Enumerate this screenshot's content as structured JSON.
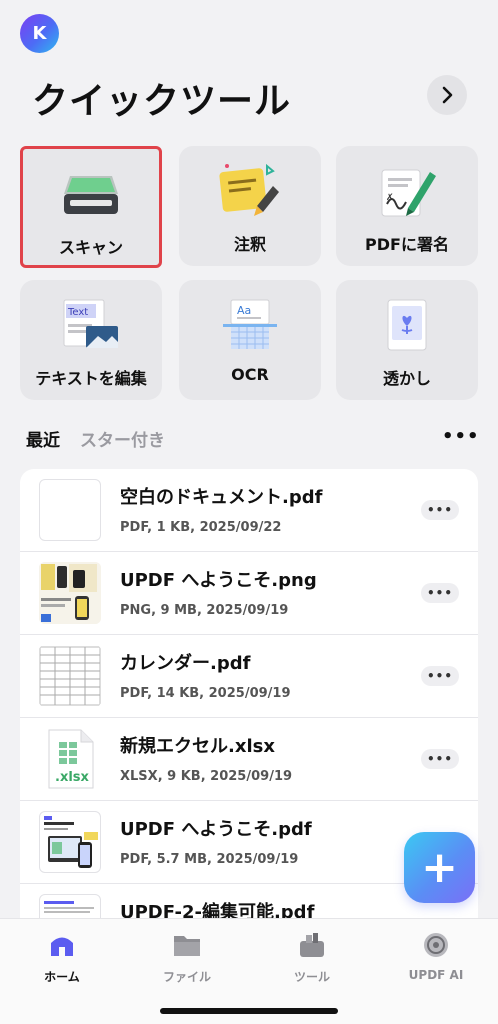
{
  "header": {
    "avatar_letter": "K",
    "title": "クイックツール"
  },
  "tools": [
    {
      "label": "スキャン",
      "icon": "scanner-icon"
    },
    {
      "label": "注釈",
      "icon": "notes-icon"
    },
    {
      "label": "PDFに署名",
      "icon": "signature-icon"
    },
    {
      "label": "テキストを編集",
      "icon": "edit-text-icon"
    },
    {
      "label": "OCR",
      "icon": "ocr-icon"
    },
    {
      "label": "透かし",
      "icon": "watermark-icon"
    }
  ],
  "tabs": {
    "recent": "最近",
    "starred": "スター付き",
    "more": "•••"
  },
  "files": [
    {
      "name": "空白のドキュメント.pdf",
      "meta": "PDF, 1 KB, 2025/09/22"
    },
    {
      "name": "UPDF へようこそ.png",
      "meta": "PNG, 9 MB, 2025/09/19"
    },
    {
      "name": "カレンダー.pdf",
      "meta": "PDF, 14 KB, 2025/09/19"
    },
    {
      "name": "新規エクセル.xlsx",
      "meta": "XLSX, 9 KB, 2025/09/19",
      "thumb_label": ".xlsx"
    },
    {
      "name": "UPDF へようこそ.pdf",
      "meta": "PDF, 5.7 MB, 2025/09/19"
    },
    {
      "name": "UPDF-2-編集可能.pdf",
      "meta": ""
    }
  ],
  "row_more": "•••",
  "fab": "+",
  "tabbar": [
    {
      "label": "ホーム",
      "icon": "home-icon",
      "active": true
    },
    {
      "label": "ファイル",
      "icon": "folder-icon",
      "active": false
    },
    {
      "label": "ツール",
      "icon": "toolbox-icon",
      "active": false
    },
    {
      "label": "UPDF AI",
      "icon": "ai-icon",
      "active": false
    }
  ],
  "colors": {
    "accent": "#5b5cf0",
    "selected_border": "#e0434a",
    "background": "#f2f2f4"
  }
}
